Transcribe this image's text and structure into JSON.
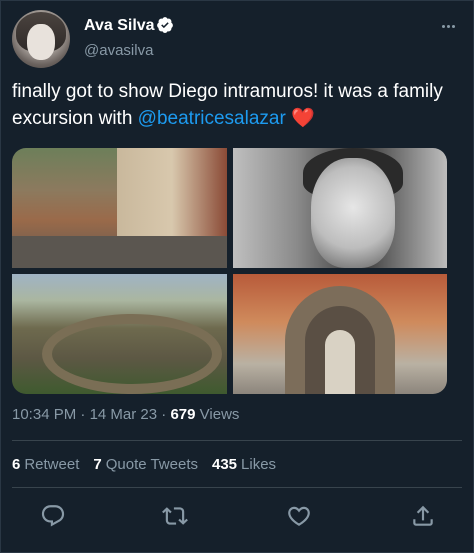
{
  "author": {
    "name": "Ava Silva",
    "handle": "@avasilva",
    "verified": true
  },
  "tweet": {
    "text_before": "finally got to show Diego intramuros! it was a family excursion with ",
    "mention": "@beatricesalazar",
    "emoji": "❤️"
  },
  "media": {
    "count": 4
  },
  "meta": {
    "time": "10:34 PM",
    "separator1": "·",
    "date": "14 Mar 23",
    "separator2": "·",
    "views_count": "679",
    "views_label": "Views"
  },
  "stats": {
    "retweets_count": "6",
    "retweets_label": "Retweet",
    "quotes_count": "7",
    "quotes_label": "Quote Tweets",
    "likes_count": "435",
    "likes_label": "Likes"
  },
  "icons": {
    "verified": "verified-badge-icon",
    "more": "more-options-icon",
    "reply": "reply-icon",
    "retweet": "retweet-icon",
    "like": "heart-icon",
    "share": "share-icon"
  },
  "colors": {
    "background": "#15202b",
    "secondary_text": "#8899a6",
    "accent": "#1d9bf0"
  }
}
